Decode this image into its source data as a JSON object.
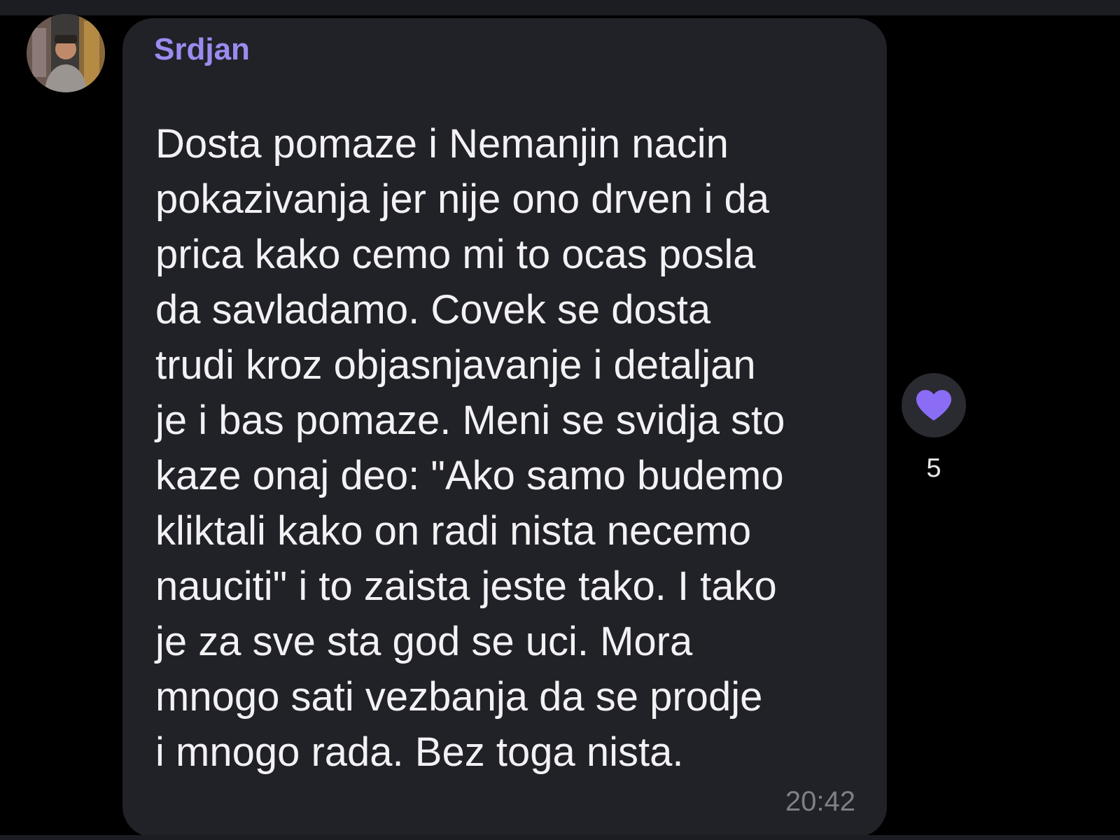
{
  "message": {
    "sender": "Srdjan",
    "text": "Dosta pomaze i Nemanjin nacin\npokazivanja jer nije ono drven i da\nprica kako cemo mi to ocas posla\nda savladamo. Covek se dosta\ntrudi kroz objasnjavanje i detaljan\nje i bas pomaze. Meni se svidja sto\nkaze onaj deo: \"Ako samo budemo\nkliktali kako on radi nista necemo\nnauciti\" i to zaista jeste tako. I tako\nje za sve sta god se uci. Mora\nmnogo sati vezbanja da se prodje\ni mnogo rada. Bez toga nista.",
    "time": "20:42"
  },
  "reaction": {
    "icon": "heart-icon",
    "color": "#8b6cf5",
    "count": "5"
  },
  "colors": {
    "background": "#000000",
    "bubble": "#212128",
    "sender_name": "#9a8cef",
    "message_text": "#f2f2f4",
    "timestamp": "#7e7f88"
  }
}
